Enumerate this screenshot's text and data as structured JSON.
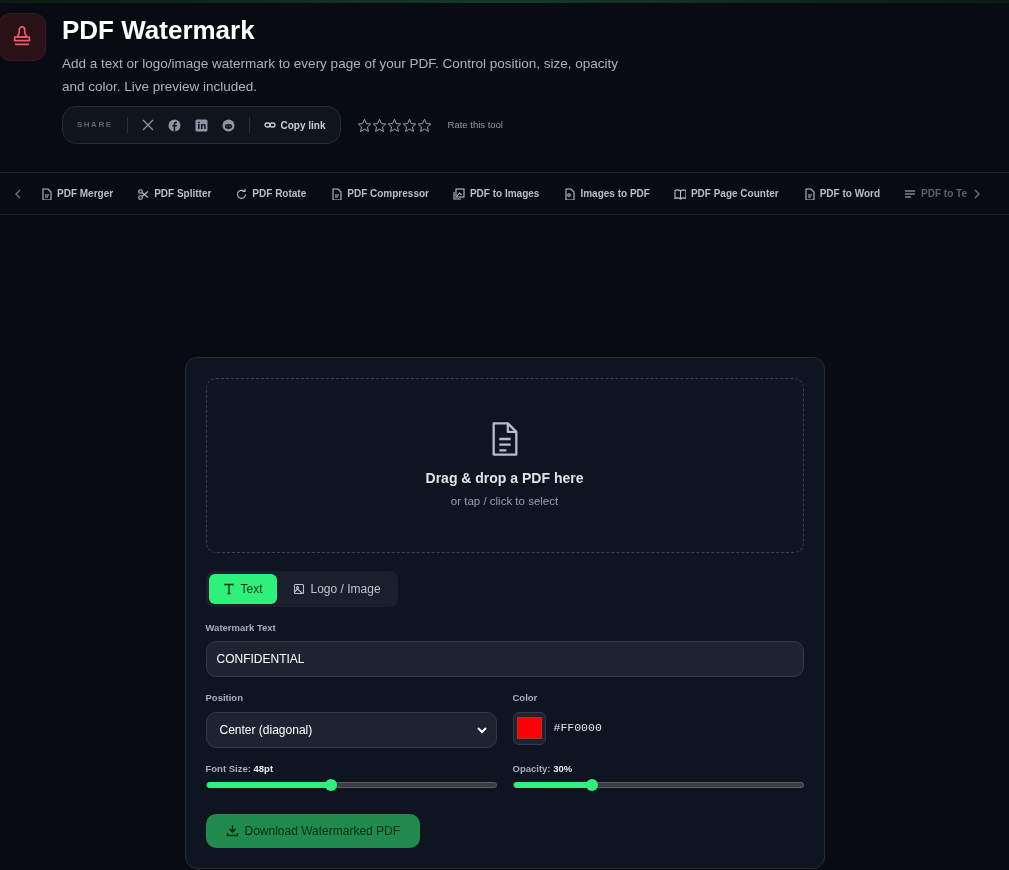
{
  "header": {
    "title": "PDF Watermark",
    "description": "Add a text or logo/image watermark to every page of your PDF. Control position, size, opacity and color. Live preview included.",
    "share_label": "SHARE",
    "copy_link": "Copy link",
    "stars": 0,
    "rate_label": "Rate this tool"
  },
  "tools_nav": [
    "PDF Merger",
    "PDF Splitter",
    "PDF Rotate",
    "PDF Compressor",
    "PDF to Images",
    "Images to PDF",
    "PDF Page Counter",
    "PDF to Word",
    "PDF to Te"
  ],
  "dropzone": {
    "title": "Drag & drop a PDF here",
    "subtitle": "or tap / click to select"
  },
  "mode_tabs": [
    {
      "label": "Text",
      "selected": true
    },
    {
      "label": "Logo / Image",
      "selected": false
    }
  ],
  "watermark_text": {
    "label": "Watermark Text",
    "value": "CONFIDENTIAL"
  },
  "position": {
    "label": "Position",
    "value": "Center (diagonal)"
  },
  "color": {
    "label": "Color",
    "value": "#FF0000"
  },
  "font_size": {
    "label": "Font Size:",
    "reading": "48pt",
    "level": 0.43
  },
  "opacity": {
    "label": "Opacity:",
    "reading": "30%",
    "level": 0.27
  },
  "download_button": "Download Watermarked PDF"
}
